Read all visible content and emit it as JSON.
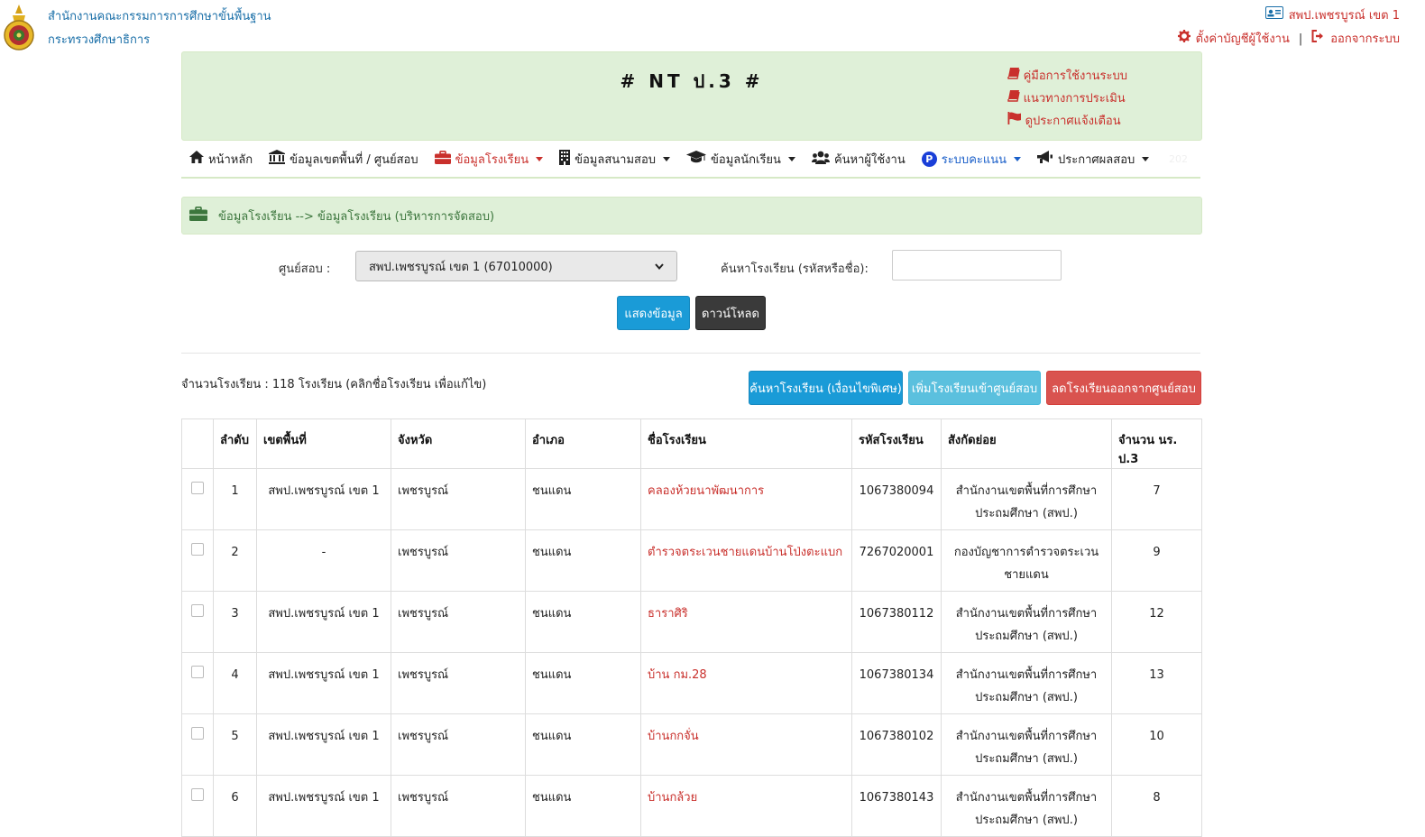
{
  "header": {
    "org_line1": "สำนักงานคณะกรรมการการศึกษาขั้นพื้นฐาน",
    "org_line2": "กระทรวงศึกษาธิการ",
    "user_name": "สพป.เพชรบูรณ์ เขต 1",
    "settings_label": "ตั้งค่าบัญชีผู้ใช้งาน",
    "logout_label": "ออกจากระบบ"
  },
  "banner": {
    "title": "# NT ป.3 #",
    "links": [
      "คู่มือการใช้งานระบบ",
      "แนวทางการประเมิน",
      "ดูประกาศแจ้งเตือน"
    ]
  },
  "nav": {
    "items": [
      "หน้าหลัก",
      "ข้อมูลเขตพื้นที่ / ศูนย์สอบ",
      "ข้อมูลโรงเรียน",
      "ข้อมูลสนามสอบ",
      "ข้อมูลนักเรียน",
      "ค้นหาผู้ใช้งาน",
      "ระบบคะแนน",
      "ประกาศผลสอบ"
    ],
    "p_badge": "P",
    "year": "202"
  },
  "breadcrumb": "ข้อมูลโรงเรียน --> ข้อมูลโรงเรียน (บริหารการจัดสอบ)",
  "filter": {
    "center_label": "ศูนย์สอบ :",
    "center_value": "สพป.เพชรบูรณ์ เขต 1 (67010000)",
    "search_label": "ค้นหาโรงเรียน (รหัสหรือชื่อ):",
    "search_value": "",
    "show_button": "แสดงข้อมูล",
    "download_button": "ดาวน์โหลด"
  },
  "summary": "จำนวนโรงเรียน : 118 โรงเรียน (คลิกชื่อโรงเรียน เพื่อแก้ไข)",
  "actions": {
    "search_cond": "ค้นหาโรงเรียน (เงื่อนไขพิเศษ)",
    "add_school": "เพิ่มโรงเรียนเข้าศูนย์สอบ",
    "remove_school": "ลดโรงเรียนออกจากศูนย์สอบ"
  },
  "table": {
    "headers": [
      "",
      "ลำดับ",
      "เขตพื้นที่",
      "จังหวัด",
      "อำเภอ",
      "ชื่อโรงเรียน",
      "รหัสโรงเรียน",
      "สังกัดย่อย",
      "จำนวน นร. ป.3"
    ],
    "rows": [
      {
        "no": "1",
        "area": "สพป.เพชรบูรณ์ เขต 1",
        "province": "เพชรบูรณ์",
        "district": "ชนแดน",
        "school": "คลองห้วยนาพัฒนาการ",
        "code": "1067380094",
        "affiliation": "สำนักงานเขตพื้นที่การศึกษาประถมศึกษา (สพป.)",
        "students": "7"
      },
      {
        "no": "2",
        "area": "-",
        "province": "เพชรบูรณ์",
        "district": "ชนแดน",
        "school": "ตำรวจตระเวนชายแดนบ้านโป่งตะแบก",
        "code": "7267020001",
        "affiliation": "กองบัญชาการตำรวจตระเวนชายแดน",
        "students": "9"
      },
      {
        "no": "3",
        "area": "สพป.เพชรบูรณ์ เขต 1",
        "province": "เพชรบูรณ์",
        "district": "ชนแดน",
        "school": "ธาราศิริ",
        "code": "1067380112",
        "affiliation": "สำนักงานเขตพื้นที่การศึกษาประถมศึกษา (สพป.)",
        "students": "12"
      },
      {
        "no": "4",
        "area": "สพป.เพชรบูรณ์ เขต 1",
        "province": "เพชรบูรณ์",
        "district": "ชนแดน",
        "school": "บ้าน กม.28",
        "code": "1067380134",
        "affiliation": "สำนักงานเขตพื้นที่การศึกษาประถมศึกษา (สพป.)",
        "students": "13"
      },
      {
        "no": "5",
        "area": "สพป.เพชรบูรณ์ เขต 1",
        "province": "เพชรบูรณ์",
        "district": "ชนแดน",
        "school": "บ้านกกจั่น",
        "code": "1067380102",
        "affiliation": "สำนักงานเขตพื้นที่การศึกษาประถมศึกษา (สพป.)",
        "students": "10"
      },
      {
        "no": "6",
        "area": "สพป.เพชรบูรณ์ เขต 1",
        "province": "เพชรบูรณ์",
        "district": "ชนแดน",
        "school": "บ้านกล้วย",
        "code": "1067380143",
        "affiliation": "สำนักงานเขตพื้นที่การศึกษาประถมศึกษา (สพป.)",
        "students": "8"
      }
    ]
  },
  "colors": {
    "accent_red": "#c9302c",
    "banner_green": "#dff0d8",
    "primary_blue": "#1a9bd7",
    "info_blue": "#5bc0de",
    "danger_red": "#d9534f"
  }
}
